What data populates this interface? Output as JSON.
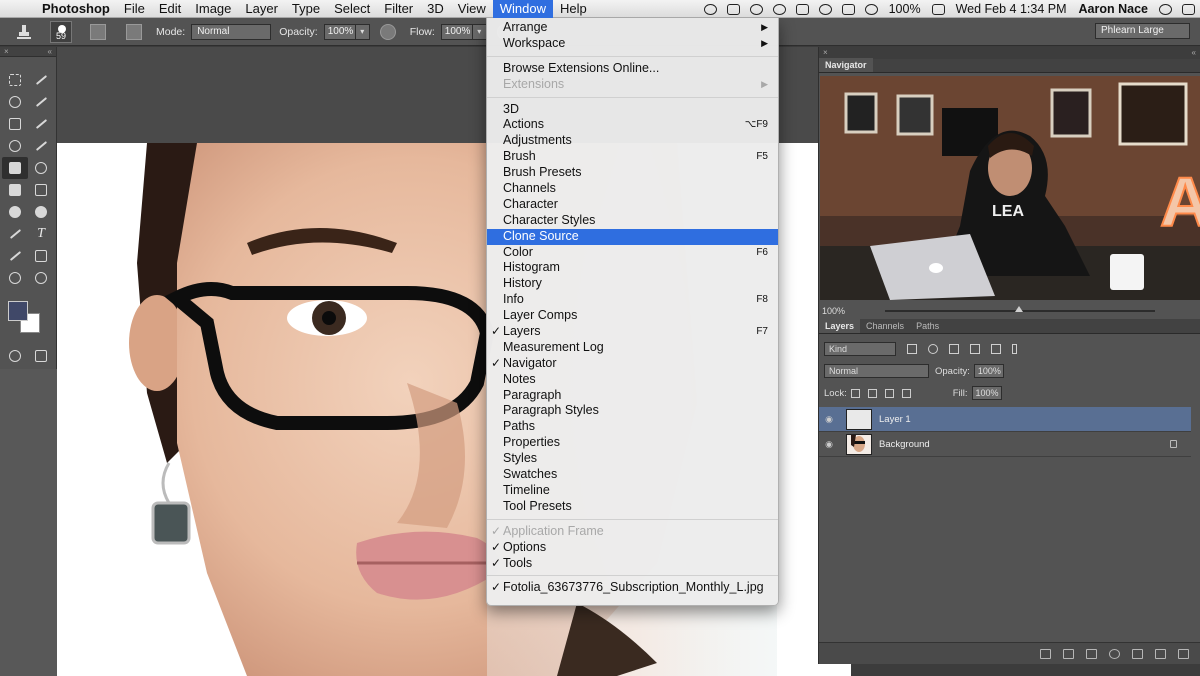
{
  "menubar": {
    "app": "Photoshop",
    "items": [
      "File",
      "Edit",
      "Image",
      "Layer",
      "Type",
      "Select",
      "Filter",
      "3D",
      "View",
      "Window",
      "Help"
    ],
    "active": "Window",
    "battery": "100%",
    "clock": "Wed Feb 4  1:34 PM",
    "user": "Aaron Nace"
  },
  "options_bar": {
    "brush_size": "59",
    "mode_label": "Mode:",
    "mode_value": "Normal",
    "opacity_label": "Opacity:",
    "opacity_value": "100%",
    "flow_label": "Flow:",
    "flow_value": "100%",
    "preset": "Phlearn Large"
  },
  "window_menu": {
    "groups": [
      [
        {
          "label": "Arrange",
          "submenu": true
        },
        {
          "label": "Workspace",
          "submenu": true
        }
      ],
      [
        {
          "label": "Browse Extensions Online..."
        },
        {
          "label": "Extensions",
          "submenu": true,
          "disabled": true
        }
      ],
      [
        {
          "label": "3D"
        },
        {
          "label": "Actions",
          "shortcut": "⌥F9"
        },
        {
          "label": "Adjustments"
        },
        {
          "label": "Brush",
          "shortcut": "F5"
        },
        {
          "label": "Brush Presets"
        },
        {
          "label": "Channels"
        },
        {
          "label": "Character"
        },
        {
          "label": "Character Styles"
        },
        {
          "label": "Clone Source",
          "highlighted": true
        },
        {
          "label": "Color",
          "shortcut": "F6"
        },
        {
          "label": "Histogram"
        },
        {
          "label": "History"
        },
        {
          "label": "Info",
          "shortcut": "F8"
        },
        {
          "label": "Layer Comps"
        },
        {
          "label": "Layers",
          "shortcut": "F7",
          "checked": true
        },
        {
          "label": "Measurement Log"
        },
        {
          "label": "Navigator",
          "checked": true
        },
        {
          "label": "Notes"
        },
        {
          "label": "Paragraph"
        },
        {
          "label": "Paragraph Styles"
        },
        {
          "label": "Paths"
        },
        {
          "label": "Properties"
        },
        {
          "label": "Styles"
        },
        {
          "label": "Swatches"
        },
        {
          "label": "Timeline"
        },
        {
          "label": "Tool Presets"
        }
      ],
      [
        {
          "label": "Application Frame",
          "checked": true,
          "disabled": true
        },
        {
          "label": "Options",
          "checked": true
        },
        {
          "label": "Tools",
          "checked": true
        }
      ],
      [
        {
          "label": "Fotolia_63673776_Subscription_Monthly_L.jpg",
          "checked": true
        }
      ]
    ]
  },
  "navigator": {
    "title": "Navigator",
    "zoom": "100%"
  },
  "layers_panel": {
    "tabs": [
      "Layers",
      "Channels",
      "Paths"
    ],
    "active_tab": "Layers",
    "kind": "Kind",
    "blend_mode": "Normal",
    "opacity_label": "Opacity:",
    "opacity_value": "100%",
    "lock_label": "Lock:",
    "fill_label": "Fill:",
    "fill_value": "100%",
    "layers": [
      {
        "name": "Layer 1",
        "active": true,
        "locked": false
      },
      {
        "name": "Background",
        "active": false,
        "locked": true
      }
    ]
  },
  "colors": {
    "menu_highlight": "#2f6ee0",
    "panel_bg": "#535353",
    "layer_selected": "#596f93",
    "foreground_color": "#404868"
  }
}
